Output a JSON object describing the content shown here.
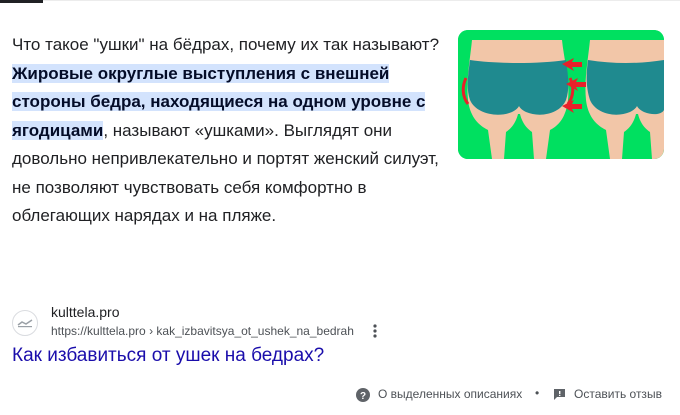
{
  "snippet": {
    "lead": "Что такое \"ушки\" на бёдрах, почему их так называют?",
    "highlight": "Жировые округлые выступления с внешней стороны бедра, находящиеся на одном уровне с ягодицами",
    "rest": ", называют «ушками». Выглядят они довольно непривлекательно и портят женский силуэт, не позволяют чувствовать себя комфортно в облегающих нарядах и на пляже."
  },
  "thumbnail": {
    "icon": "hips-illustration",
    "background": "#00e060",
    "arrow_color": "#e8202a"
  },
  "source": {
    "name": "kulttela.pro",
    "url_base": "https://kulttela.pro",
    "url_separator": "›",
    "url_path": "kak_izbavitsya_ot_ushek_na_bedrah",
    "more_icon": "three-dots-vertical-icon"
  },
  "result": {
    "title": "Как избавиться от ушек на бедрах?",
    "link_color": "#1a0dab"
  },
  "footer": {
    "about_label": "О выделенных описаниях",
    "about_icon": "help-circle-icon",
    "separator": "•",
    "feedback_label": "Оставить отзыв",
    "feedback_icon": "feedback-icon"
  },
  "colors": {
    "highlight_bg": "#d3e3fd",
    "text": "#202124",
    "muted": "#4d5156"
  }
}
